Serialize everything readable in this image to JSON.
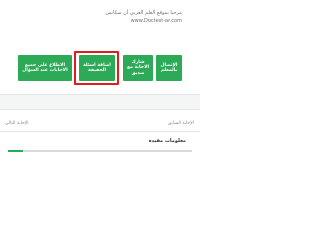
{
  "site": {
    "title": "مرحبا بموقع العلم العربي أن سكانس",
    "url": "www.Doctest-ar.com"
  },
  "actions": {
    "buttons": [
      {
        "label": "الإتصال بالمعلم"
      },
      {
        "label": "شارك الاجابة مع صديق"
      },
      {
        "label": "اضافة اسئلة الحقيقة"
      },
      {
        "label": "الاطلاع على جميع الاجابات عند السؤال"
      }
    ],
    "highlighted_button": "اضافة اسئلة الحقيقة"
  },
  "navigation": {
    "previous_label": "الإجابة السابق",
    "next_label": "الإجابة التالي"
  },
  "info": {
    "heading": "معلومات مفيدة"
  },
  "progress": {
    "fraction": 0.08
  },
  "colors": {
    "accent_green": "#2daa58",
    "highlight_red": "#e21b1b"
  }
}
